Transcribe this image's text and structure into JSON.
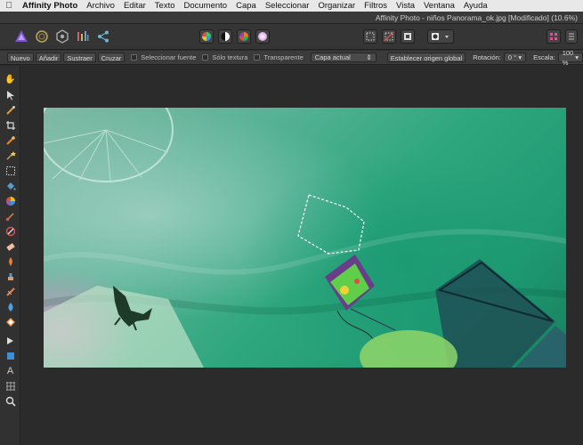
{
  "menubar": {
    "app": "Affinity Photo",
    "items": [
      "Archivo",
      "Editar",
      "Texto",
      "Documento",
      "Capa",
      "Seleccionar",
      "Organizar",
      "Filtros",
      "Vista",
      "Ventana",
      "Ayuda"
    ]
  },
  "window": {
    "title": "Affinity Photo - niños Panorama_ok.jpg [Modificado] (10.6%)"
  },
  "context": {
    "buttons": [
      "Nuevo",
      "Añadir",
      "Sustraer",
      "Cruzar"
    ],
    "select_font_label": "Seleccionar fuente",
    "text_only_label": "Sólo textura",
    "transparent_label": "Transparente",
    "layer_select_value": "Capa actual",
    "set_origin_label": "Establecer origen global",
    "rotation_label": "Rotación:",
    "rotation_value": "0 °",
    "scale_label": "Escala:",
    "scale_value": "100 %"
  },
  "colors": {
    "accent": "#7b52c9",
    "menubar_bg": "#e8e8e8",
    "panel_bg": "#353535",
    "selection": "#ffffff"
  },
  "tools": [
    "hand-icon",
    "move-icon",
    "color-picker-icon",
    "crop-icon",
    "brush-select-icon",
    "flood-select-icon",
    "marquee-icon",
    "fill-icon",
    "gradient-icon",
    "paint-brush-icon",
    "color-replace-icon",
    "erase-icon",
    "dodge-icon",
    "clone-icon",
    "healing-icon",
    "blur-icon",
    "selection-brush-icon",
    "node-icon",
    "shape-icon",
    "text-icon",
    "mesh-warp-icon",
    "zoom-icon"
  ]
}
